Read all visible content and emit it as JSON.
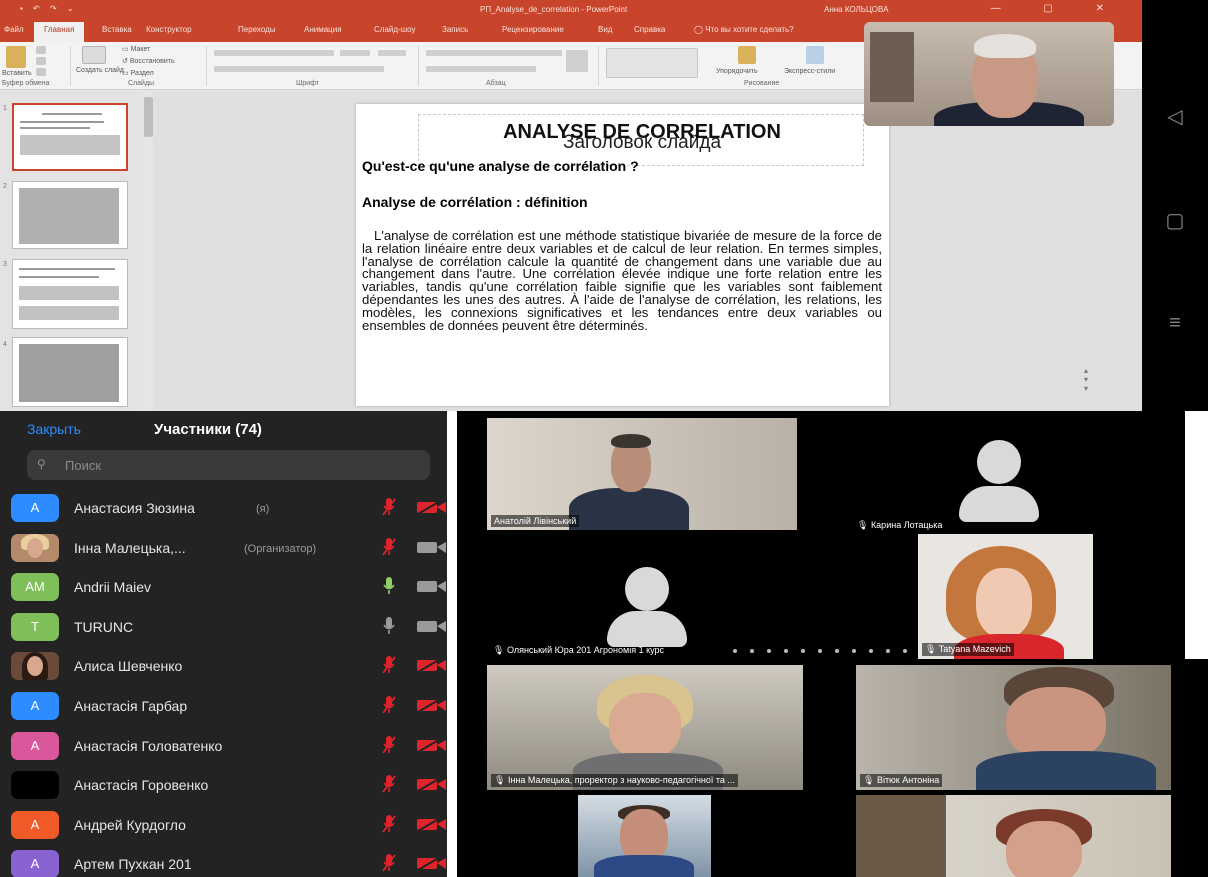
{
  "powerpoint": {
    "window_title": "РП_Analyse_de_correlation - PowerPoint",
    "user_name": "Анна КОЛЬЦОВА",
    "tabs": [
      "Файл",
      "Главная",
      "Вставка",
      "Конструктор",
      "Переходы",
      "Анимация",
      "Слайд-шоу",
      "Запись",
      "Рецензирование",
      "Вид",
      "Справка",
      "Что вы хотите сделать?"
    ],
    "active_tab": "Главная",
    "ribbon": {
      "paste": "Вставить",
      "create_slide": "Создать слайд",
      "layout": "Макет",
      "reset": "Восстановить",
      "section": "Раздел",
      "arrange": "Упорядочить",
      "express_styles": "Экспресс-стили",
      "groups": {
        "clipboard": "Буфер обмена",
        "slides": "Слайды",
        "font": "Шрифт",
        "paragraph": "Абзац",
        "drawing": "Рисование"
      }
    },
    "thumbnail_numbers": [
      "1",
      "2",
      "3",
      "4"
    ],
    "slide": {
      "title": "ANALYSE DE CORRELATION",
      "title_placeholder": "Заголовок слайда",
      "heading1": "Qu'est-ce qu'une analyse de corrélation ?",
      "heading2": "Analyse de corrélation : définition",
      "body": "L'analyse de corrélation est une méthode statistique bivariée de mesure de la force de la relation linéaire entre deux variables et de calcul de leur relation. En termes simples, l'analyse de corrélation calcule la quantité de changement dans une variable due au changement dans l'autre. Une corrélation élevée indique une forte relation entre les variables, tandis qu'une corrélation faible signifie que les variables sont faiblement dépendantes les unes des autres. À l'aide de l'analyse de corrélation, les relations, les modèles, les connexions significatives et les tendances entre deux variables ou ensembles de données peuvent être déterminés."
    }
  },
  "android_nav": {
    "back": "◁",
    "home": "▢",
    "recents": "≡"
  },
  "participants_panel": {
    "close_label": "Закрыть",
    "title": "Участники (74)",
    "search_placeholder": "Поиск",
    "search_icon": "search-icon",
    "people": [
      {
        "initials": "A",
        "name": "Анастасия Зюзина",
        "suffix": "(я)",
        "avatar_color": "#2d8cff",
        "mic": "muted",
        "cam": "off"
      },
      {
        "initials": "",
        "name": "Інна Малецька,...",
        "suffix": "(Организатор)",
        "avatar_color": "#b58a6a",
        "avatar_photo": "blonde-woman",
        "mic": "muted",
        "cam": "on"
      },
      {
        "initials": "AM",
        "name": "Andrii Maiev",
        "suffix": "",
        "avatar_color": "#7fbf5a",
        "mic": "on",
        "cam": "on"
      },
      {
        "initials": "T",
        "name": "TURUNC",
        "suffix": "",
        "avatar_color": "#7fbf5a",
        "mic": "idle",
        "cam": "on"
      },
      {
        "initials": "",
        "name": "Алиса Шевченко",
        "suffix": "",
        "avatar_color": "#6b4a3a",
        "avatar_photo": "dark-hair-woman",
        "mic": "muted",
        "cam": "off"
      },
      {
        "initials": "A",
        "name": "Анастасія Гарбар",
        "suffix": "",
        "avatar_color": "#2d8cff",
        "mic": "muted",
        "cam": "off"
      },
      {
        "initials": "A",
        "name": "Анастасія Головатенко",
        "suffix": "",
        "avatar_color": "#d9579b",
        "mic": "muted",
        "cam": "off"
      },
      {
        "initials": "",
        "name": "Анастасія Горовенко",
        "suffix": "",
        "avatar_color": "#000000",
        "mic": "muted",
        "cam": "off"
      },
      {
        "initials": "A",
        "name": "Андрей Курдогло",
        "suffix": "",
        "avatar_color": "#f05a28",
        "mic": "muted",
        "cam": "off"
      },
      {
        "initials": "A",
        "name": "Артем Пухкан 201",
        "suffix": "",
        "avatar_color": "#8a63d2",
        "mic": "muted",
        "cam": "off"
      }
    ],
    "colors": {
      "muted": "#e0242c",
      "active": "#8ed06a",
      "idle": "#9a9a9a",
      "cam_on": "#9a9a9a",
      "cam_off": "#e0242c"
    }
  },
  "gallery": {
    "tiles": [
      {
        "id": "anatolii",
        "label": "Анатолій Лівінський"
      },
      {
        "id": "karyna",
        "label": "Карина Лотацька"
      },
      {
        "id": "olianskyi",
        "label": "Олянський Юра 201 Агрономія 1 курс"
      },
      {
        "id": "tatyana",
        "label": "Tatyana Mazevich"
      },
      {
        "id": "inna",
        "label": "Інна Малецька, проректор з науково-педагогічної та ..."
      },
      {
        "id": "vitiuk",
        "label": "Вітюк Антоніна"
      },
      {
        "id": "man-bottom",
        "label": ""
      },
      {
        "id": "woman-bottom",
        "label": ""
      }
    ]
  }
}
